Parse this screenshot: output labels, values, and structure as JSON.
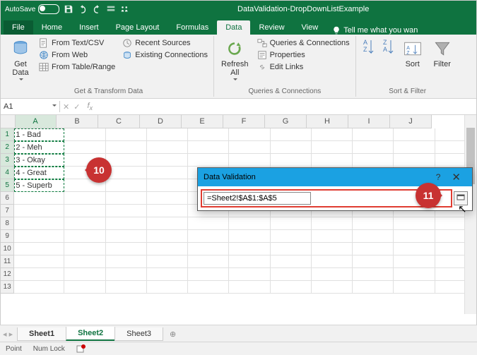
{
  "titlebar": {
    "autosave_label": "AutoSave",
    "autosave_state": "Off",
    "filename": "DataValidation-DropDownListExample"
  },
  "tabs": {
    "file": "File",
    "home": "Home",
    "insert": "Insert",
    "pagelayout": "Page Layout",
    "formulas": "Formulas",
    "data": "Data",
    "review": "Review",
    "view": "View",
    "tellme": "Tell me what you wan"
  },
  "ribbon": {
    "get_data": "Get\nData",
    "from_text": "From Text/CSV",
    "from_web": "From Web",
    "from_table": "From Table/Range",
    "recent": "Recent Sources",
    "existing": "Existing Connections",
    "group1_label": "Get & Transform Data",
    "refresh": "Refresh\nAll",
    "queries": "Queries & Connections",
    "properties": "Properties",
    "editlinks": "Edit Links",
    "group2_label": "Queries & Connections",
    "sort": "Sort",
    "filter": "Filter",
    "group3_label": "Sort & Filter"
  },
  "formula_bar": {
    "namebox": "A1"
  },
  "columns": [
    "A",
    "B",
    "C",
    "D",
    "E",
    "F",
    "G",
    "H",
    "I",
    "J"
  ],
  "cells": {
    "a1": "1 - Bad",
    "a2": "2 - Meh",
    "a3": "3 - Okay",
    "a4": "4 - Great",
    "a5": "5 - Superb"
  },
  "dialog": {
    "title": "Data Validation",
    "help": "?",
    "close": "✕",
    "formula": "=Sheet2!$A$1:$A$5"
  },
  "callouts": {
    "c10": "10",
    "c11": "11"
  },
  "sheets": {
    "s1": "Sheet1",
    "s2": "Sheet2",
    "s3": "Sheet3",
    "add": "⊕"
  },
  "status": {
    "mode": "Point",
    "numlock": "Num Lock"
  }
}
